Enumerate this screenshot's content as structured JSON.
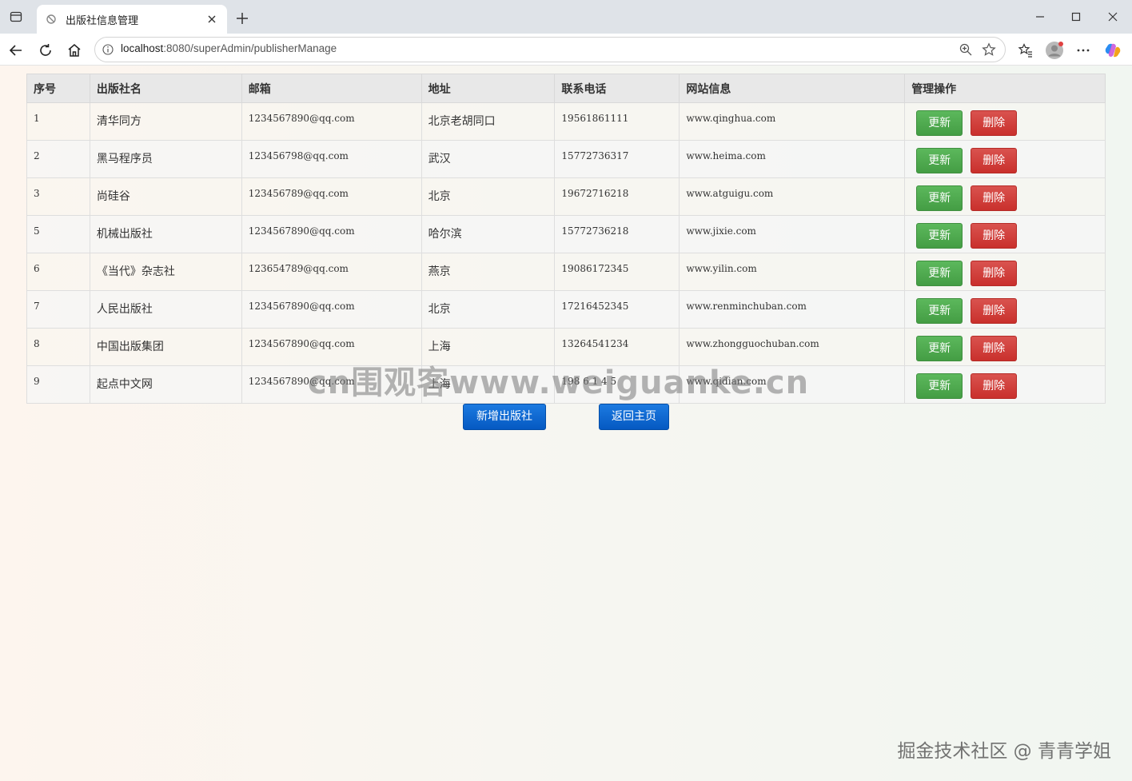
{
  "browser": {
    "tab_title": "出版社信息管理",
    "url_host": "localhost",
    "url_path": ":8080/superAdmin/publisherManage"
  },
  "table": {
    "headers": [
      "序号",
      "出版社名",
      "邮箱",
      "地址",
      "联系电话",
      "网站信息",
      "管理操作"
    ],
    "rows": [
      {
        "id": "1",
        "name": "清华同方",
        "email": "1234567890@qq.com",
        "address": "北京老胡同口",
        "phone": "19561861111",
        "website": "www.qinghua.com"
      },
      {
        "id": "2",
        "name": "黑马程序员",
        "email": "123456798@qq.com",
        "address": "武汉",
        "phone": "15772736317",
        "website": "www.heima.com"
      },
      {
        "id": "3",
        "name": "尚硅谷",
        "email": "123456789@qq.com",
        "address": "北京",
        "phone": "19672716218",
        "website": "www.atguigu.com"
      },
      {
        "id": "5",
        "name": "机械出版社",
        "email": "1234567890@qq.com",
        "address": "哈尔滨",
        "phone": "15772736218",
        "website": "www.jixie.com"
      },
      {
        "id": "6",
        "name": "《当代》杂志社",
        "email": "123654789@qq.com",
        "address": "燕京",
        "phone": "19086172345",
        "website": "www.yilin.com"
      },
      {
        "id": "7",
        "name": "人民出版社",
        "email": "1234567890@qq.com",
        "address": "北京",
        "phone": "17216452345",
        "website": "www.renminchuban.com"
      },
      {
        "id": "8",
        "name": "中国出版集团",
        "email": "1234567890@qq.com",
        "address": "上海",
        "phone": "13264541234",
        "website": "www.zhongguochuban.com"
      },
      {
        "id": "9",
        "name": "起点中文网",
        "email": "1234567890@qq.com",
        "address": "上海",
        "phone": "198 6 1 4 5",
        "website": "www.qidian.com"
      }
    ],
    "update_label": "更新",
    "delete_label": "删除"
  },
  "actions": {
    "add_label": "新增出版社",
    "home_label": "返回主页"
  },
  "overlay": {
    "watermark": "cn围观客www.weiguanke.cn",
    "credit": "掘金技术社区 @ 青青学姐"
  }
}
